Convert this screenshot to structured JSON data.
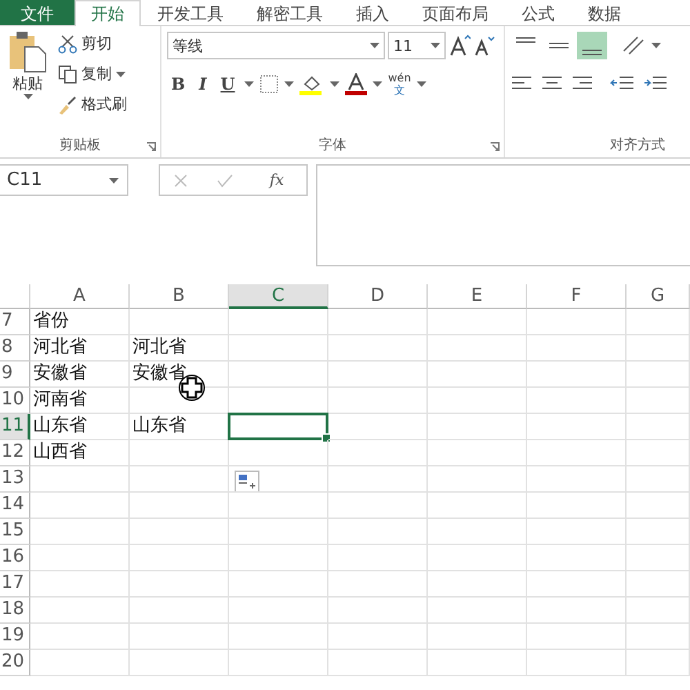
{
  "tabs": [
    {
      "label": "文件",
      "kind": "file",
      "selected": false
    },
    {
      "label": "开始",
      "kind": "tab",
      "selected": true
    },
    {
      "label": "开发工具",
      "kind": "tab",
      "selected": false
    },
    {
      "label": "解密工具",
      "kind": "tab",
      "selected": false
    },
    {
      "label": "插入",
      "kind": "tab",
      "selected": false
    },
    {
      "label": "页面布局",
      "kind": "tab",
      "selected": false
    },
    {
      "label": "公式",
      "kind": "tab",
      "selected": false
    },
    {
      "label": "数据",
      "kind": "tab",
      "selected": false
    }
  ],
  "clipboard": {
    "paste": "粘贴",
    "cut": "剪切",
    "copy": "复制",
    "format_painter": "格式刷",
    "label": "剪贴板"
  },
  "font": {
    "name": "等线",
    "size": "11",
    "bold": "B",
    "italic": "I",
    "underline": "U",
    "phonetic_top": "wén",
    "phonetic_bottom": "文",
    "label": "字体"
  },
  "alignment": {
    "label": "对齐方式",
    "vertical": [
      {
        "kind": "top",
        "selected": false
      },
      {
        "kind": "middle",
        "selected": false
      },
      {
        "kind": "bottom",
        "selected": true
      }
    ]
  },
  "formula_bar": {
    "name_box": "C11",
    "fx": "fx"
  },
  "columns": [
    {
      "label": "A",
      "selected": false
    },
    {
      "label": "B",
      "selected": false
    },
    {
      "label": "C",
      "selected": true
    },
    {
      "label": "D",
      "selected": false
    },
    {
      "label": "E",
      "selected": false
    },
    {
      "label": "F",
      "selected": false
    },
    {
      "label": "G",
      "selected": false
    }
  ],
  "rows": [
    {
      "number": "7",
      "selected": false,
      "cells": [
        "省份",
        ""
      ]
    },
    {
      "number": "8",
      "selected": false,
      "cells": [
        "河北省",
        "河北省"
      ]
    },
    {
      "number": "9",
      "selected": false,
      "cells": [
        "安徽省",
        "安徽省"
      ]
    },
    {
      "number": "10",
      "selected": false,
      "cells": [
        "河南省",
        ""
      ]
    },
    {
      "number": "11",
      "selected": true,
      "cells": [
        "山东省",
        "山东省"
      ]
    },
    {
      "number": "12",
      "selected": false,
      "cells": [
        "山西省",
        ""
      ]
    },
    {
      "number": "13",
      "selected": false,
      "cells": [
        "",
        ""
      ]
    },
    {
      "number": "14",
      "selected": false,
      "cells": [
        "",
        ""
      ]
    },
    {
      "number": "15",
      "selected": false,
      "cells": [
        "",
        ""
      ]
    },
    {
      "number": "16",
      "selected": false,
      "cells": [
        "",
        ""
      ]
    },
    {
      "number": "17",
      "selected": false,
      "cells": [
        "",
        ""
      ]
    },
    {
      "number": "18",
      "selected": false,
      "cells": [
        "",
        ""
      ]
    },
    {
      "number": "19",
      "selected": false,
      "cells": [
        "",
        ""
      ]
    },
    {
      "number": "20",
      "selected": false,
      "cells": [
        "",
        ""
      ]
    }
  ]
}
